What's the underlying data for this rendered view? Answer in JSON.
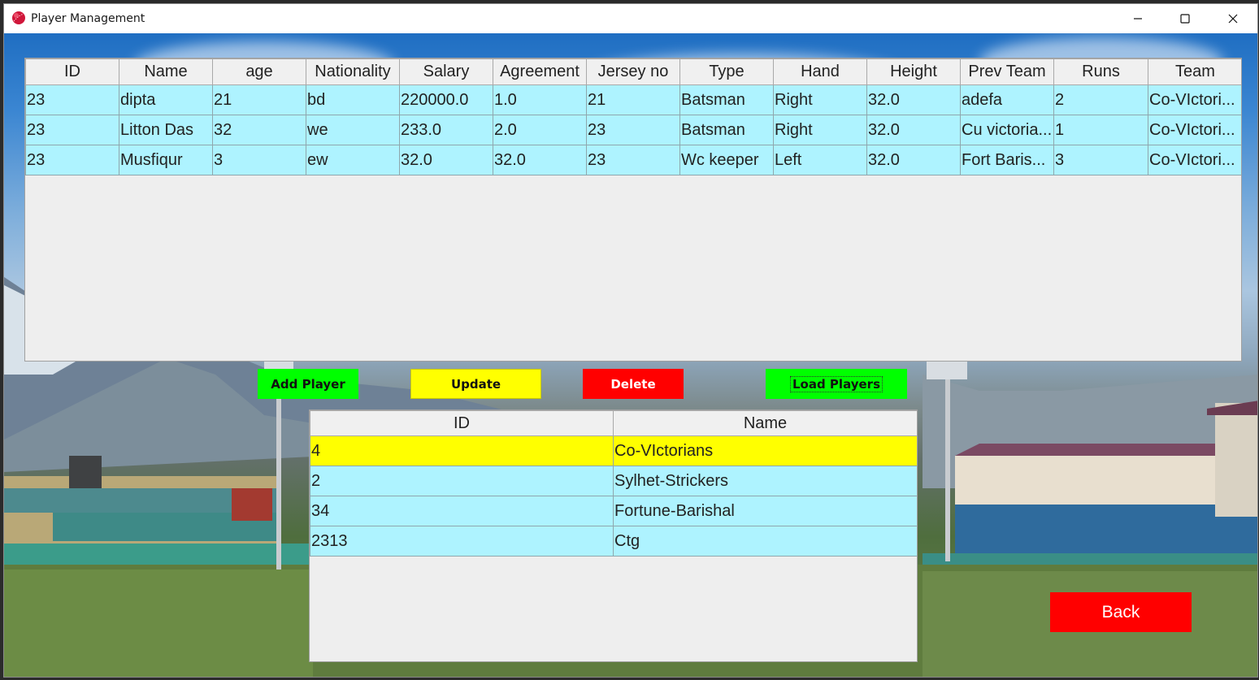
{
  "window": {
    "title": "Player Management",
    "icon": "cricket-ball-icon",
    "controls": [
      "minimize-icon",
      "maximize-icon",
      "close-icon"
    ]
  },
  "players_table": {
    "columns": [
      "ID",
      "Name",
      "age",
      "Nationality",
      "Salary",
      "Agreement",
      "Jersey no",
      "Type",
      "Hand",
      "Height",
      "Prev Team",
      "Runs",
      "Team"
    ],
    "rows": [
      [
        "23",
        "dipta",
        "21",
        "bd",
        "220000.0",
        "1.0",
        "21",
        "Batsman",
        "Right",
        "32.0",
        "adefa",
        "2",
        "Co-VIctori..."
      ],
      [
        "23",
        "Litton Das",
        "32",
        "we",
        "233.0",
        "2.0",
        "23",
        "Batsman",
        "Right",
        "32.0",
        "Cu victoria...",
        "1",
        "Co-VIctori..."
      ],
      [
        "23",
        "Musfiqur",
        "3",
        "ew",
        "32.0",
        "32.0",
        "23",
        "Wc keeper",
        "Left",
        "32.0",
        "Fort Baris...",
        "3",
        "Co-VIctori..."
      ]
    ]
  },
  "actions": {
    "add_label": "Add Player",
    "update_label": "Update",
    "delete_label": "Delete",
    "load_label": "Load Players",
    "back_label": "Back"
  },
  "teams_table": {
    "columns": [
      "ID",
      "Name"
    ],
    "rows": [
      [
        "4",
        "Co-VIctorians"
      ],
      [
        "2",
        "Sylhet-Strickers"
      ],
      [
        "34",
        "Fortune-Barishal"
      ],
      [
        "2313",
        "Ctg"
      ]
    ],
    "selected_index": 0
  },
  "colors": {
    "row_bg": "#aef3ff",
    "selected_row": "#ffff00",
    "green_button": "#00ff00",
    "yellow_button": "#ffff00",
    "red_button": "#ff0000"
  }
}
